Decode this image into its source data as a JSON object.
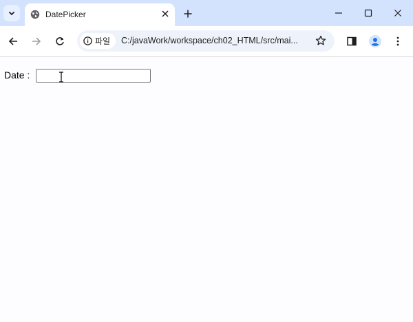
{
  "browser": {
    "tab_title": "DatePicker",
    "site_chip_label": "파일",
    "address": "C:/javaWork/workspace/ch02_HTML/src/mai..."
  },
  "page": {
    "date_label": "Date :",
    "date_value": ""
  },
  "icons": [
    "tab-search-chevron-icon",
    "globe-icon",
    "close-icon",
    "plus-icon",
    "minimize-icon",
    "maximize-icon",
    "window-close-icon",
    "back-arrow-icon",
    "forward-arrow-icon",
    "reload-icon",
    "info-icon",
    "star-icon",
    "side-panel-icon",
    "profile-icon",
    "kebab-menu-icon",
    "text-cursor-icon"
  ],
  "colors": {
    "tabstrip": "#d3e3fd",
    "omnibox": "#eef3fb",
    "profile_accent": "#1a73e8"
  }
}
